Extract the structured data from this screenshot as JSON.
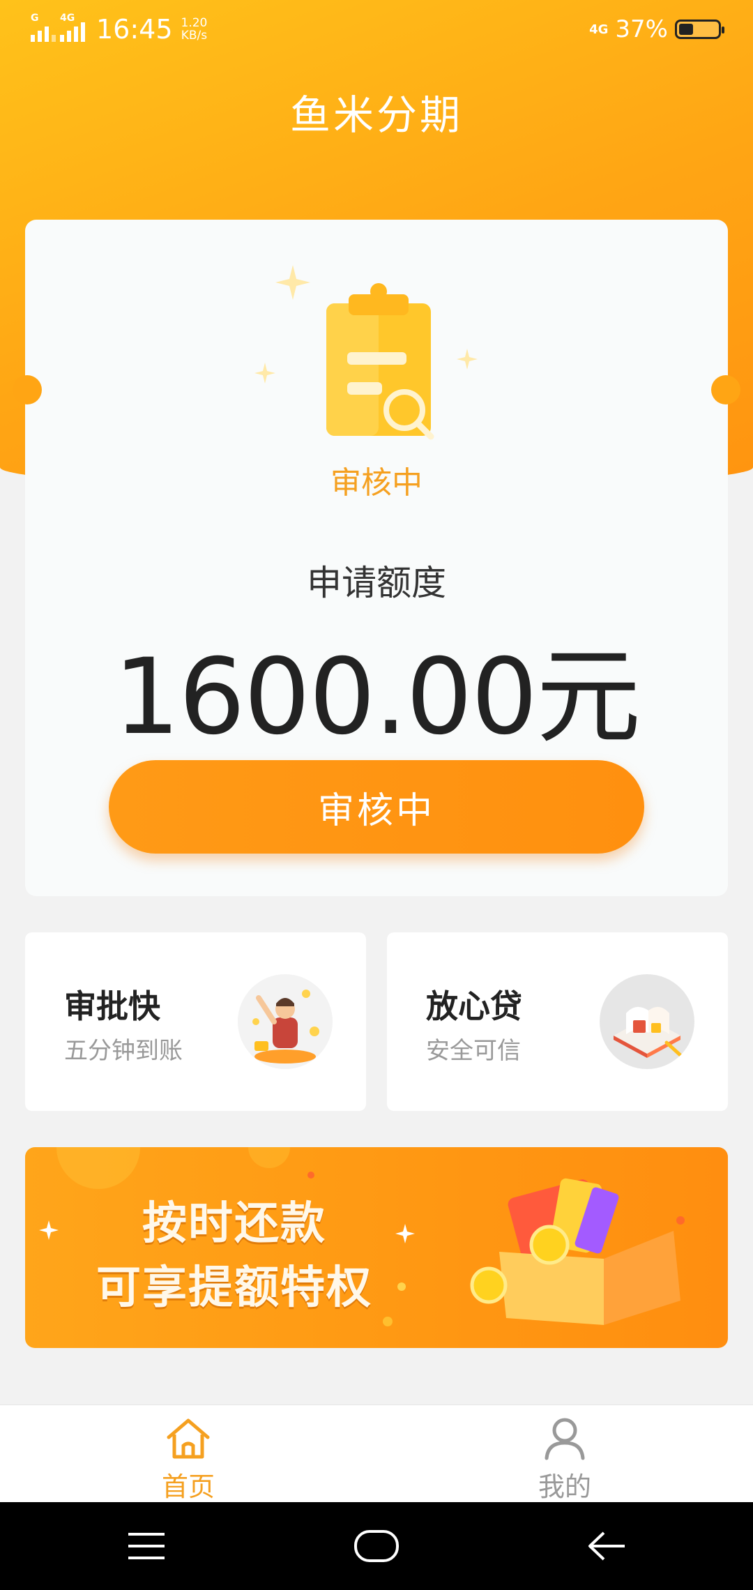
{
  "status_bar": {
    "network_left_1": "G",
    "network_left_2": "4G",
    "time": "16:45",
    "speed_value": "1.20",
    "speed_unit": "KB/s",
    "network_right": "4G",
    "battery_percent": "37%",
    "battery_level": 0.37
  },
  "header": {
    "title": "鱼米分期"
  },
  "application": {
    "status_caption": "审核中",
    "amount_label": "申请额度",
    "amount_value": "1600.00元",
    "action_label": "审核中"
  },
  "features": [
    {
      "title": "审批快",
      "subtitle": "五分钟到账"
    },
    {
      "title": "放心贷",
      "subtitle": "安全可信"
    }
  ],
  "promo_banner": {
    "line1": "按时还款",
    "line2": "可享提额特权"
  },
  "bottom_nav": [
    {
      "label": "首页",
      "icon": "home-icon",
      "active": true
    },
    {
      "label": "我的",
      "icon": "user-icon",
      "active": false
    }
  ],
  "colors": {
    "accent": "#ff9a16",
    "active_tab": "#f5a020",
    "inactive_tab": "#999999"
  }
}
